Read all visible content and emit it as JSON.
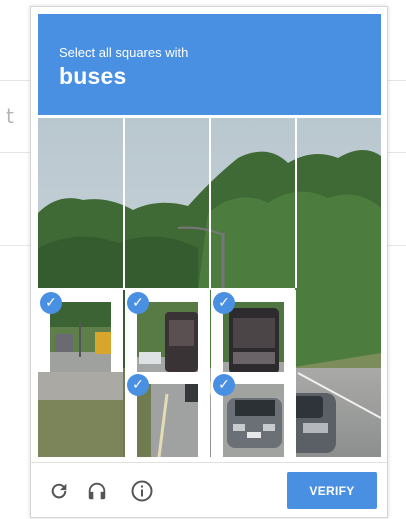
{
  "challenge": {
    "instruction": "Select all squares with",
    "object": "buses"
  },
  "grid": {
    "rows": 3,
    "cols": 4,
    "selected_cells": [
      "r1c0",
      "r1c1",
      "r1c2",
      "r2c1",
      "r2c2"
    ],
    "check_symbol": "✓"
  },
  "footer": {
    "reload_icon": "reload-icon",
    "audio_icon": "headphones-icon",
    "info_icon": "info-icon",
    "verify_label": "VERIFY"
  },
  "colors": {
    "accent": "#4a90e2",
    "icon": "#555555"
  }
}
